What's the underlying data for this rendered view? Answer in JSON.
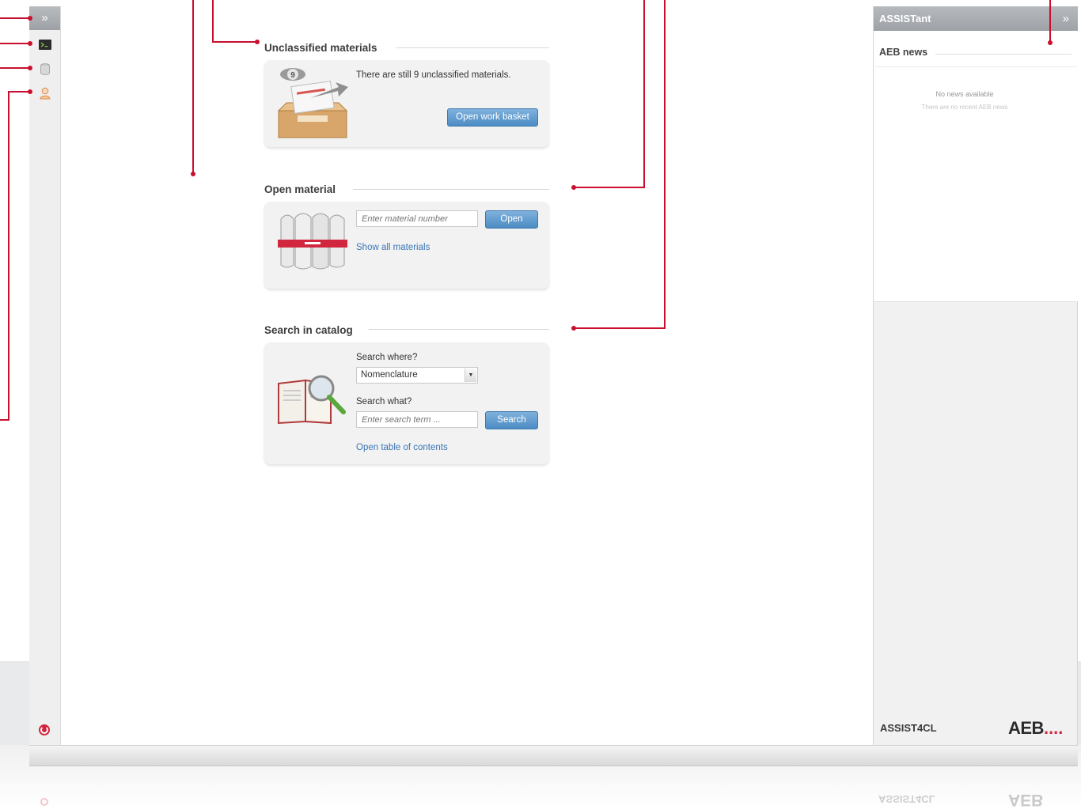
{
  "left_rail": {
    "expand_label": "»",
    "icons": [
      "console-icon",
      "database-icon",
      "user-icon"
    ],
    "power_icon": "power-icon"
  },
  "sections": {
    "unclassified": {
      "title": "Unclassified materials",
      "badge_count": "9",
      "message": "There are still 9 unclassified materials.",
      "button": "Open work basket"
    },
    "open_material": {
      "title": "Open material",
      "input_placeholder": "Enter material number",
      "button": "Open",
      "link": "Show all materials"
    },
    "search_catalog": {
      "title": "Search in catalog",
      "where_label": "Search where?",
      "where_value": "Nomenclature",
      "what_label": "Search what?",
      "what_placeholder": "Enter search term ...",
      "button": "Search",
      "link": "Open table of contents"
    }
  },
  "right_panel": {
    "title": "ASSISTant",
    "collapse_label": "»",
    "news_title": "AEB news",
    "news_empty": "No news available",
    "news_empty_sub": "There are no recent AEB news",
    "footer_product": "ASSIST4CL",
    "footer_logo": "AEB",
    "footer_logo_dots": "...."
  },
  "colors": {
    "accent_blue": "#4c8cc4",
    "callout_red": "#c8102e",
    "header_gray": "#a6aaae"
  }
}
